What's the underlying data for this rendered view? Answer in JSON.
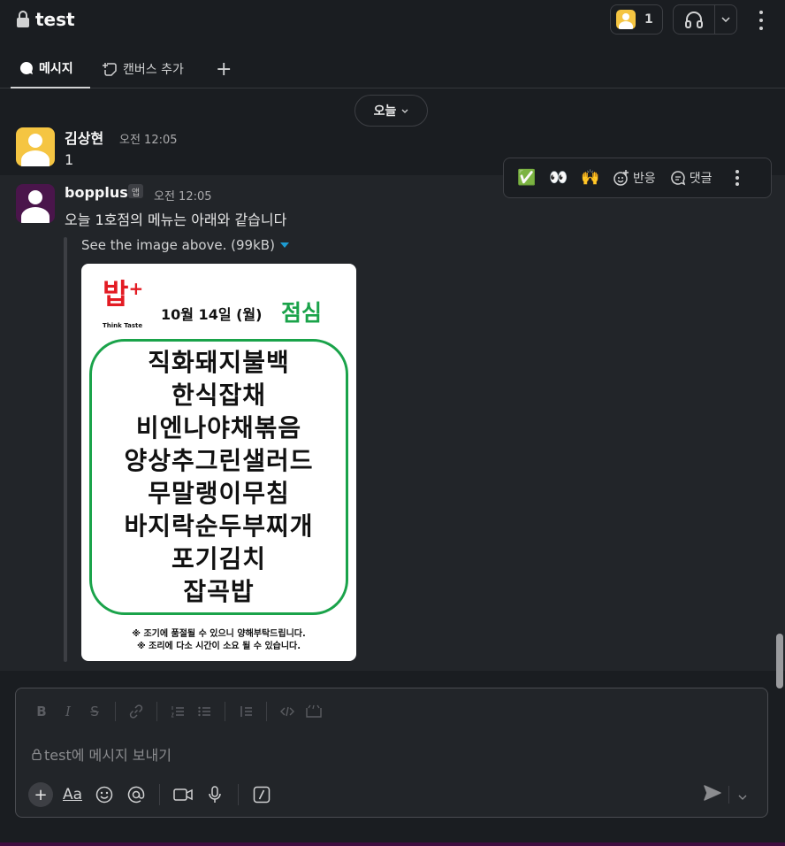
{
  "channel": {
    "name": "test"
  },
  "header": {
    "member_count": "1"
  },
  "tabs": [
    {
      "label": "메시지"
    },
    {
      "label": "캔버스 추가"
    },
    {
      "label": "+"
    }
  ],
  "date_divider": {
    "label": "오늘"
  },
  "messages": [
    {
      "sender": "김상현",
      "time": "오전 12:05",
      "text": "1"
    },
    {
      "sender": "bopplus",
      "badge": "앱",
      "time": "오전 12:05",
      "text": "오늘 1호점의 메뉴는 아래와 같습니다",
      "attachment_meta": "See the image above. (99kB)"
    }
  ],
  "menu_image": {
    "logo": "밥",
    "logo_plus": "+",
    "logo_sub": "Think Taste",
    "date": "10월 14일 (월)",
    "meal": "점심",
    "items": [
      "직화돼지불백",
      "한식잡채",
      "비엔나야채볶음",
      "양상추그린샐러드",
      "무말랭이무침",
      "바지락순두부찌개",
      "포기김치",
      "잡곡밥"
    ],
    "notes": [
      "※ 조기에 품절될 수 있으니 양해부탁드립니다.",
      "※ 조리에 다소 시간이 소요 될 수 있습니다."
    ]
  },
  "hover_actions": {
    "emoji1": "✅",
    "emoji2": "👀",
    "emoji3": "🙌",
    "react_label": "반응",
    "reply_label": "댓글"
  },
  "composer": {
    "placeholder": "test에 메시지 보내기",
    "aa_label": "Aa"
  },
  "icons": {
    "lock": "lock-icon",
    "headphones": "headphones-icon",
    "chevron": "chevron-down-icon",
    "kebab": "more-vertical-icon",
    "send": "send-icon"
  },
  "colors": {
    "background": "#1a1d21",
    "hover_row": "#222529",
    "menu_green": "#1aa34a",
    "logo_red": "#e31b23",
    "link_blue": "#1d9bd1",
    "avatar_yellow": "#f5c542",
    "avatar_purple": "#4a154b"
  }
}
